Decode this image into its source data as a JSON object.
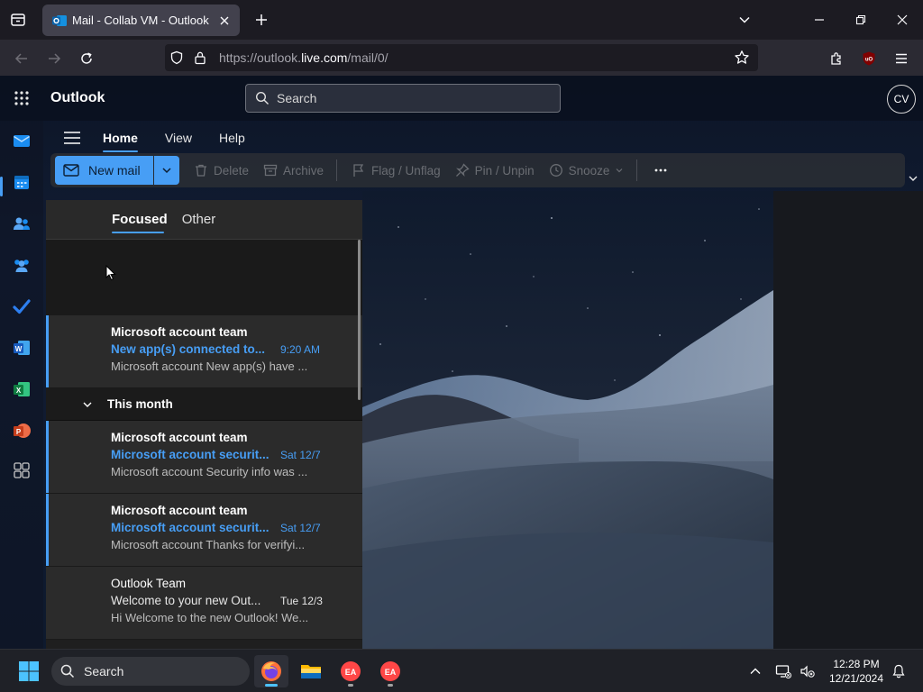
{
  "browser": {
    "tab_title": "Mail - Collab VM - Outlook",
    "url_prefix": "https://outlook.",
    "url_domain": "live.com",
    "url_suffix": "/mail/0/"
  },
  "app": {
    "brand": "Outlook",
    "search_placeholder": "Search",
    "avatar_initials": "CV"
  },
  "ribbon": {
    "tabs": [
      "Home",
      "View",
      "Help"
    ],
    "new_mail": "New mail",
    "delete": "Delete",
    "archive": "Archive",
    "flag": "Flag / Unflag",
    "pin": "Pin / Unpin",
    "snooze": "Snooze"
  },
  "mail_list": {
    "pivots": [
      "Focused",
      "Other"
    ],
    "group_label": "This month",
    "messages": [
      {
        "from": "Microsoft account team",
        "subject": "New app(s) connected to...",
        "time": "9:20 AM",
        "preview": "Microsoft account New app(s) have ...",
        "unread": true
      },
      {
        "from": "Microsoft account team",
        "subject": "Microsoft account securit...",
        "time": "Sat 12/7",
        "preview": "Microsoft account Security info was ...",
        "unread": true
      },
      {
        "from": "Microsoft account team",
        "subject": "Microsoft account securit...",
        "time": "Sat 12/7",
        "preview": "Microsoft account Thanks for verifyi...",
        "unread": true
      },
      {
        "from": "Outlook Team",
        "subject": "Welcome to your new Out...",
        "time": "Tue 12/3",
        "preview": "Hi Welcome to the new Outlook! We...",
        "unread": false
      }
    ]
  },
  "taskbar": {
    "search_label": "Search",
    "time": "12:28 PM",
    "date": "12/21/2024"
  },
  "colors": {
    "accent": "#479ef5",
    "browser_bg": "#1c1b22",
    "taskbar_bg": "#1f2127"
  }
}
